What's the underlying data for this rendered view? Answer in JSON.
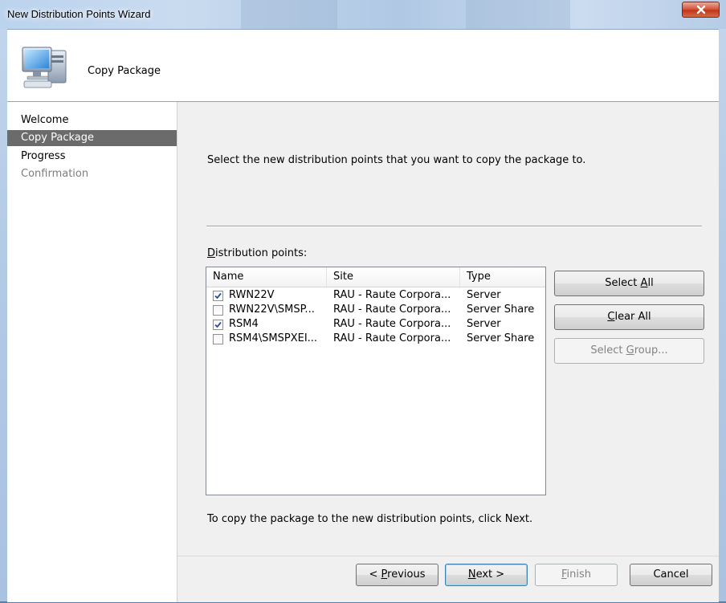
{
  "window": {
    "title": "New Distribution Points Wizard",
    "accent": "#c3d6ec",
    "close_color": "#c1361b"
  },
  "header": {
    "title": "Copy Package",
    "icon": "computer-monitor-icon"
  },
  "nav": {
    "items": [
      {
        "label": "Welcome",
        "state": "normal"
      },
      {
        "label": "Copy Package",
        "state": "active"
      },
      {
        "label": "Progress",
        "state": "normal"
      },
      {
        "label": "Confirmation",
        "state": "disabled"
      }
    ]
  },
  "main": {
    "instruction": "Select the new distribution points that you want to copy the package to.",
    "list_label_mnemonic": "D",
    "list_label_rest": "istribution points:",
    "columns": [
      "Name",
      "Site",
      "Type"
    ],
    "rows": [
      {
        "checked": true,
        "name": "RWN22V",
        "site": "RAU - Raute Corpora...",
        "type": "Server"
      },
      {
        "checked": false,
        "name": "RWN22V\\SMSP...",
        "site": "RAU - Raute Corpora...",
        "type": "Server Share"
      },
      {
        "checked": true,
        "name": "RSM4",
        "site": "RAU - Raute Corpora...",
        "type": "Server"
      },
      {
        "checked": false,
        "name": "RSM4\\SMSPXEI...",
        "site": "RAU - Raute Corpora...",
        "type": "Server Share"
      }
    ],
    "bottom_note": "To copy the package to the new distribution points, click Next."
  },
  "side_buttons": {
    "select_all_pre": "Select ",
    "select_all_mn": "A",
    "select_all_post": "ll",
    "clear_all_mn": "C",
    "clear_all_post": "lear All",
    "select_group_pre": "Select ",
    "select_group_mn": "G",
    "select_group_post": "roup..."
  },
  "footer": {
    "previous_pre": "< ",
    "previous_mn": "P",
    "previous_post": "revious",
    "next_mn": "N",
    "next_post": "ext >",
    "finish_mn": "F",
    "finish_post": "inish",
    "cancel": "Cancel"
  }
}
